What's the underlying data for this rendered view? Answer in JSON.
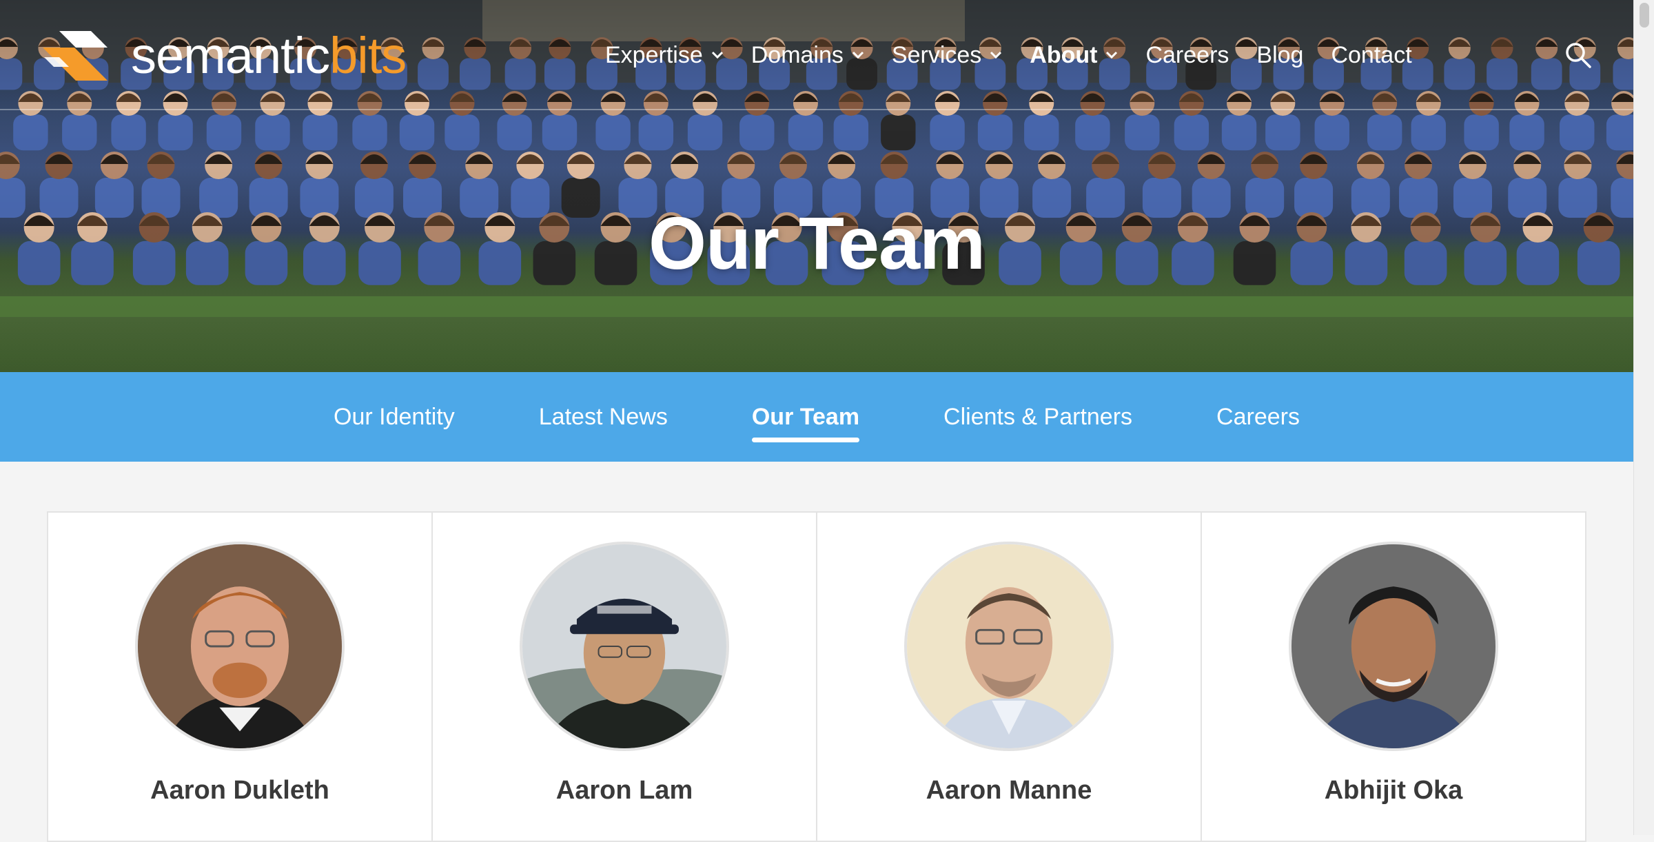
{
  "brand": {
    "name_main": "semantic",
    "name_accent": "bits",
    "accent_color": "#f59b2a"
  },
  "nav": {
    "items": [
      {
        "label": "Expertise",
        "has_dropdown": true
      },
      {
        "label": "Domains",
        "has_dropdown": true
      },
      {
        "label": "Services",
        "has_dropdown": true
      },
      {
        "label": "About",
        "has_dropdown": true,
        "active": true
      },
      {
        "label": "Careers",
        "has_dropdown": false
      },
      {
        "label": "Blog",
        "has_dropdown": false
      },
      {
        "label": "Contact",
        "has_dropdown": false
      }
    ],
    "search_icon": "search-icon"
  },
  "hero": {
    "title": "Our Team"
  },
  "subnav": {
    "items": [
      {
        "label": "Our Identity"
      },
      {
        "label": "Latest News"
      },
      {
        "label": "Our Team",
        "active": true
      },
      {
        "label": "Clients & Partners"
      },
      {
        "label": "Careers"
      }
    ],
    "background_color": "#4da8e8"
  },
  "team": {
    "members": [
      {
        "name": "Aaron Dukleth"
      },
      {
        "name": "Aaron Lam"
      },
      {
        "name": "Aaron Manne"
      },
      {
        "name": "Abhijit Oka"
      }
    ]
  }
}
